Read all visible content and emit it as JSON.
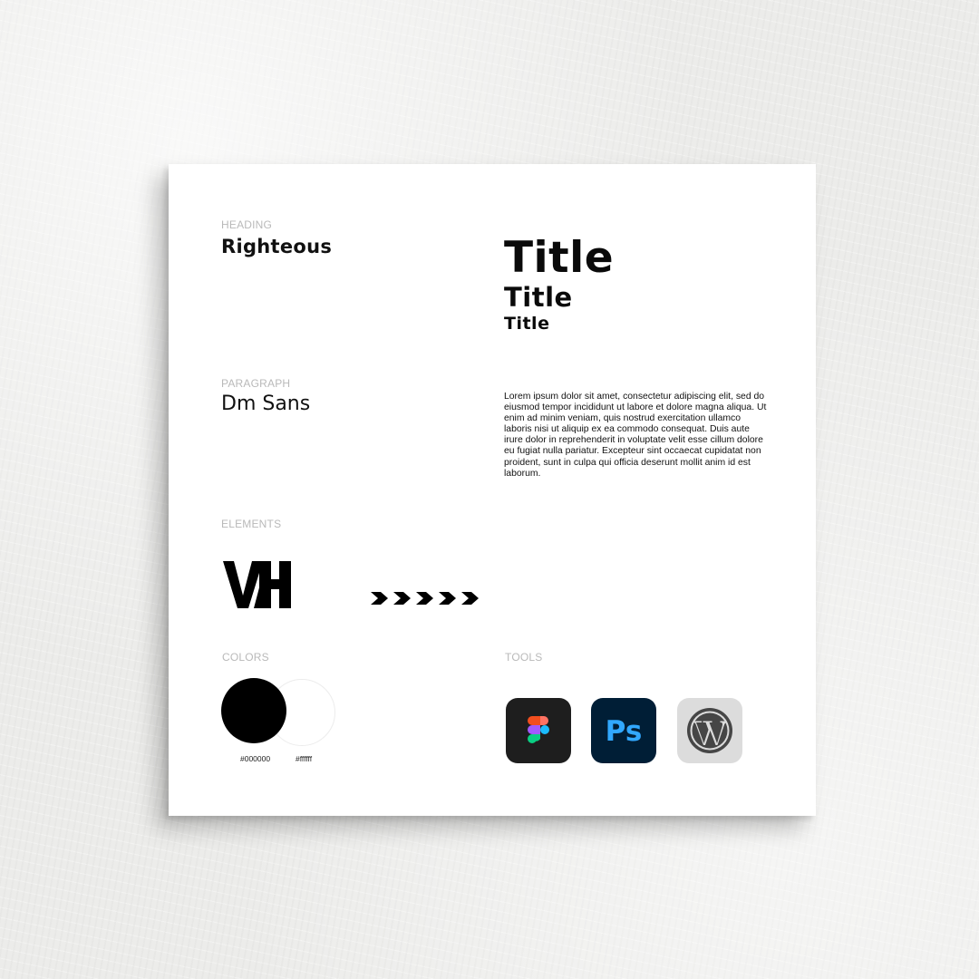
{
  "heading": {
    "label": "HEADING",
    "font_name": "Righteous"
  },
  "titles": [
    "Title",
    "Title",
    "Title"
  ],
  "paragraph": {
    "label": "PARAGRAPH",
    "font_name": "Dm Sans",
    "sample_text": "Lorem ipsum dolor sit amet, consectetur adipiscing elit, sed do eiusmod tempor incididunt ut labore et dolore magna aliqua. Ut enim ad minim veniam, quis nostrud exercitation ullamco laboris nisi ut aliquip ex ea commodo consequat. Duis aute irure dolor in reprehenderit in voluptate velit esse cillum dolore eu fugiat nulla pariatur. Excepteur sint occaecat cupidatat non proident, sunt in culpa qui officia deserunt mollit anim id est laborum."
  },
  "elements": {
    "label": "ELEMENTS",
    "logo_icon": "vh-monogram-logo",
    "chevrons_icon": "chevron-right-row-icon",
    "chevron_count": 5
  },
  "colors": {
    "label": "COLORS",
    "swatches": [
      {
        "hex": "#000000",
        "label": "#000000"
      },
      {
        "hex": "#ffffff",
        "label": "#ffffff"
      }
    ]
  },
  "tools": {
    "label": "TOOLS",
    "items": [
      {
        "icon": "figma-icon",
        "bg": "#1e1e1e"
      },
      {
        "icon": "photoshop-icon",
        "bg": "#001e36",
        "text": "Ps"
      },
      {
        "icon": "wordpress-icon",
        "bg": "#dcdcdc"
      }
    ]
  }
}
